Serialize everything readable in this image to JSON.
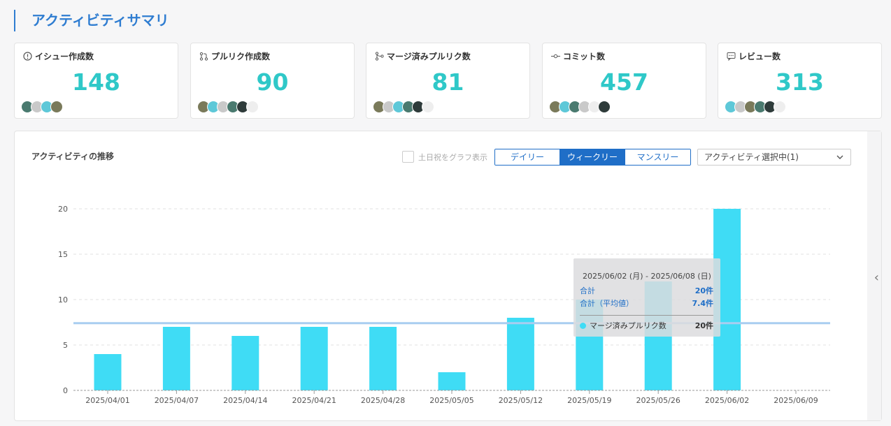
{
  "page_title": "アクティビティサマリ",
  "cards": [
    {
      "label": "イシュー作成数",
      "icon": "issue-icon",
      "value": "148",
      "avatar_colors": [
        "#4a7a6f",
        "#c9c9c9",
        "#5ec8d8",
        "#7a7a5a"
      ]
    },
    {
      "label": "プルリク作成数",
      "icon": "pull-request-icon",
      "value": "90",
      "avatar_colors": [
        "#7a7a5a",
        "#5ec8d8",
        "#c9c9c9",
        "#4a7a6f",
        "#2e3b3a",
        "#eeeeee"
      ]
    },
    {
      "label": "マージ済みプルリク数",
      "icon": "merge-icon",
      "value": "81",
      "avatar_colors": [
        "#7a7a5a",
        "#c9c9c9",
        "#5ec8d8",
        "#4a7a6f",
        "#2e3b3a",
        "#eeeeee"
      ]
    },
    {
      "label": "コミット数",
      "icon": "commit-icon",
      "value": "457",
      "avatar_colors": [
        "#7a7a5a",
        "#5ec8d8",
        "#4a7a6f",
        "#c9c9c9",
        "#eeeeee",
        "#2e3b3a"
      ]
    },
    {
      "label": "レビュー数",
      "icon": "review-icon",
      "value": "313",
      "avatar_colors": [
        "#5ec8d8",
        "#c9c9c9",
        "#7a7a5a",
        "#4a7a6f",
        "#2e3b3a",
        "#eeeeee"
      ]
    }
  ],
  "panel": {
    "title": "アクティビティの推移",
    "weekend_label": "土日祝をグラフ表示",
    "weekend_checked": false,
    "periods": [
      "デイリー",
      "ウィークリー",
      "マンスリー"
    ],
    "active_period": "ウィークリー",
    "activity_select": "アクティビティ選択中(1)"
  },
  "tooltip": {
    "range": "2025/06/02 (月) - 2025/06/08 (日)",
    "total_label": "合計",
    "total_value": "20件",
    "avg_label": "合計（平均値）",
    "avg_value": "7.4件",
    "series_name": "マージ済みプルリク数",
    "series_value": "20件"
  },
  "chart_data": {
    "type": "bar",
    "categories": [
      "2025/04/01",
      "2025/04/07",
      "2025/04/14",
      "2025/04/21",
      "2025/04/28",
      "2025/05/05",
      "2025/05/12",
      "2025/05/19",
      "2025/05/26",
      "2025/06/02",
      "2025/06/09"
    ],
    "series": [
      {
        "name": "マージ済みプルリク数",
        "color": "#3fdcf5",
        "values": [
          4,
          7,
          6,
          7,
          7,
          2,
          8,
          10,
          12,
          20,
          0
        ]
      }
    ],
    "average_line": 7.4,
    "average_color": "#a9cdf0",
    "ylim": [
      0,
      20
    ],
    "yticks": [
      0,
      5,
      10,
      15,
      20
    ],
    "grid": true,
    "highlighted_category": "2025/06/02"
  }
}
